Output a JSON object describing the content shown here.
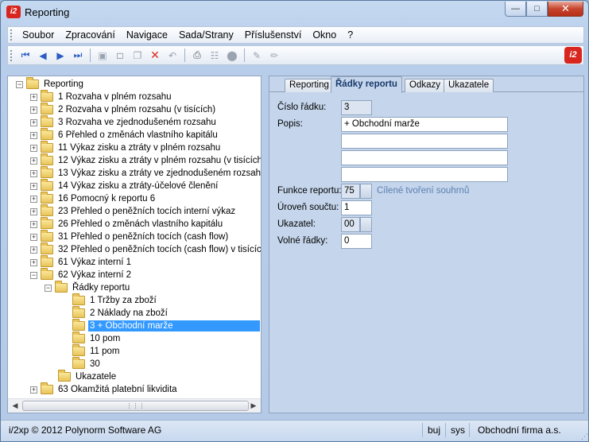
{
  "window": {
    "title": "Reporting",
    "app_icon": "i2",
    "controls": [
      "minimize-icon",
      "maximize-icon",
      "close-icon"
    ]
  },
  "menu": {
    "items": [
      "Soubor",
      "Zpracování",
      "Navigace",
      "Sada/Strany",
      "Příslušenství",
      "Okno",
      "?"
    ]
  },
  "toolbar": {
    "icons": [
      "first-record-icon",
      "previous-record-icon",
      "next-record-icon",
      "last-record-icon",
      "save-icon",
      "new-document-icon",
      "copy-icon",
      "delete-icon",
      "undo-icon",
      "print-icon",
      "structure-icon",
      "stop-icon",
      "edit-icon",
      "clear-edit-icon"
    ],
    "logo": "i2"
  },
  "tree": {
    "root": "Reporting",
    "items": [
      "1 Rozvaha v plném rozsahu",
      "2 Rozvaha v plném rozsahu (v tisících)",
      "3 Rozvaha ve zjednodušeném rozsahu",
      "6 Přehled o změnách vlastního kapitálu",
      "11 Výkaz zisku a ztráty v plném rozsahu",
      "12 Výkaz zisku a ztráty v plném rozsahu (v tisících)",
      "13 Výkaz zisku a ztráty ve zjednodušeném rozsahu",
      "14 Výkaz zisku a ztráty-účelové členění",
      "16 Pomocný k reportu 6",
      "23 Přehled o peněžních tocích interní výkaz",
      "26 Přehled o změnách vlastního kapitálu",
      "31 Přehled o peněžních tocích (cash flow)",
      "32 Přehled o peněžních tocích (cash flow) v tisících",
      "61 Výkaz interní 1",
      "62 Výkaz interní 2"
    ],
    "sub_folder": "Řádky reportu",
    "rows": [
      "1 Tržby za zboží",
      "2 Náklady na zboží",
      "3 + Obchodní marže",
      "10 pom",
      "11 pom",
      "30"
    ],
    "selected_row": "3 + Obchodní marže",
    "ukazatele": "Ukazatele",
    "last_item": "63 Okamžitá platební likvidita"
  },
  "tabs": [
    "Reporting",
    "Řádky reportu",
    "Odkazy",
    "Ukazatele"
  ],
  "active_tab": "Řádky reportu",
  "form": {
    "cislo_label": "Číslo řádku:",
    "cislo_value": "3",
    "popis_label": "Popis:",
    "popis_lines": [
      "+ Obchodní marže",
      "",
      "",
      "",
      ""
    ],
    "funkce_label": "Funkce reportu:",
    "funkce_value": "75",
    "funkce_hint": "Cílené tvoření souhrnů",
    "uroven_label": "Úroveň součtu:",
    "uroven_value": "1",
    "ukazatel_label": "Ukazatel:",
    "ukazatel_value": "00",
    "volne_label": "Volné řádky:",
    "volne_value": "0"
  },
  "status": {
    "copyright": "i/2xp © 2012 Polynorm Software AG",
    "user": "buj",
    "db": "sys",
    "company": "Obchodní firma a.s."
  }
}
